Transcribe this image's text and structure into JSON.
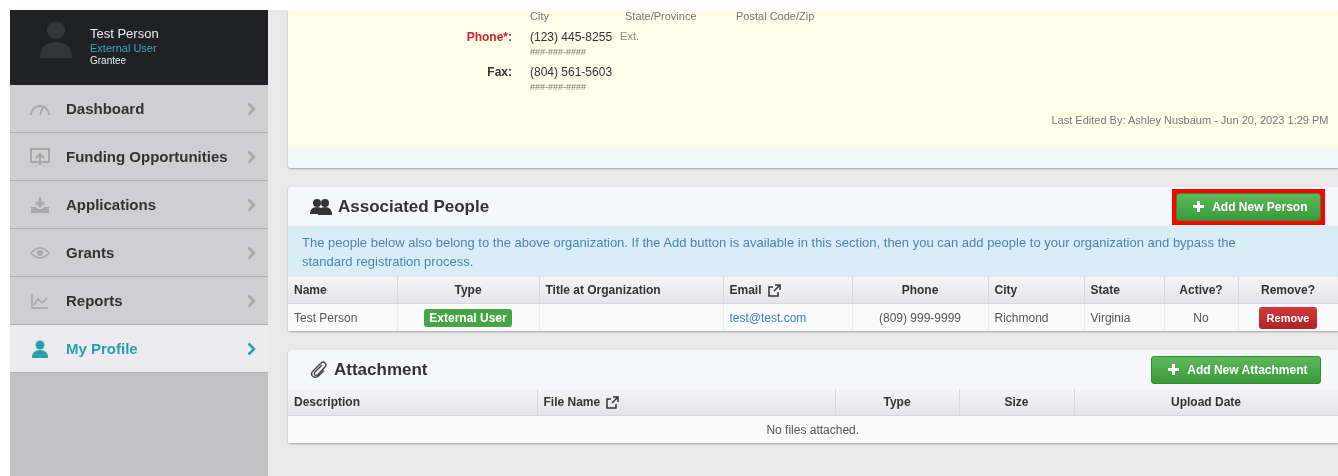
{
  "user": {
    "name": "Test Person",
    "role": "External User",
    "group": "Grantee"
  },
  "nav": [
    {
      "label": "Dashboard",
      "kind": "gauge",
      "selected": false
    },
    {
      "label": "Funding Opportunities",
      "kind": "upload",
      "selected": false
    },
    {
      "label": "Applications",
      "kind": "download",
      "selected": false
    },
    {
      "label": "Grants",
      "kind": "eye",
      "selected": false
    },
    {
      "label": "Reports",
      "kind": "chart",
      "selected": false
    },
    {
      "label": "My Profile",
      "kind": "person",
      "selected": true
    }
  ],
  "contact": {
    "address_sublabels": [
      "City",
      "State/Province",
      "Postal Code/Zip"
    ],
    "fields": [
      {
        "label": "Phone*:",
        "required": true,
        "value": "(123) 445-8255",
        "ext_label": "Ext.",
        "hint": "###-###-####"
      },
      {
        "label": "Fax:",
        "required": false,
        "value": "(804) 561-5603",
        "hint": "###-###-####"
      }
    ],
    "last_edited": "Last Edited By: Ashley Nusbaum - Jun 20, 2023 1:29 PM"
  },
  "people": {
    "title": "Associated People",
    "add_button": {
      "label": "Add New Person",
      "highlighted": true
    },
    "notice": "The people below also belong to the above organization. If the Add button is available in this section, then you can add people to your organization and bypass the standard registration process.",
    "columns": [
      {
        "label": "Name",
        "link_icon": false
      },
      {
        "label": "Type",
        "link_icon": false
      },
      {
        "label": "Title at Organization",
        "link_icon": false
      },
      {
        "label": "Email",
        "link_icon": true
      },
      {
        "label": "Phone",
        "link_icon": false
      },
      {
        "label": "City",
        "link_icon": false
      },
      {
        "label": "State",
        "link_icon": false
      },
      {
        "label": "Active?",
        "link_icon": false
      },
      {
        "label": "Remove?",
        "link_icon": false
      }
    ],
    "rows": [
      {
        "cells": [
          {
            "kind": "text",
            "text": "Test Person"
          },
          {
            "kind": "badge",
            "text": "External User"
          },
          {
            "kind": "empty"
          },
          {
            "kind": "link",
            "text": "test@test.com"
          },
          {
            "kind": "text",
            "text": "(809) 999-9999"
          },
          {
            "kind": "text",
            "text": "Richmond"
          },
          {
            "kind": "text",
            "text": "Virginia"
          },
          {
            "kind": "text",
            "text": "No"
          },
          {
            "kind": "button",
            "text": "Remove"
          }
        ]
      }
    ]
  },
  "attachments": {
    "title": "Attachment",
    "add_button": {
      "label": "Add New Attachment",
      "highlighted": false
    },
    "columns": [
      {
        "label": "Description",
        "link_icon": false
      },
      {
        "label": "File Name",
        "link_icon": true
      },
      {
        "label": "Type",
        "link_icon": false
      },
      {
        "label": "Size",
        "link_icon": false
      },
      {
        "label": "Upload Date",
        "link_icon": false
      }
    ],
    "empty_message": "No files attached."
  }
}
